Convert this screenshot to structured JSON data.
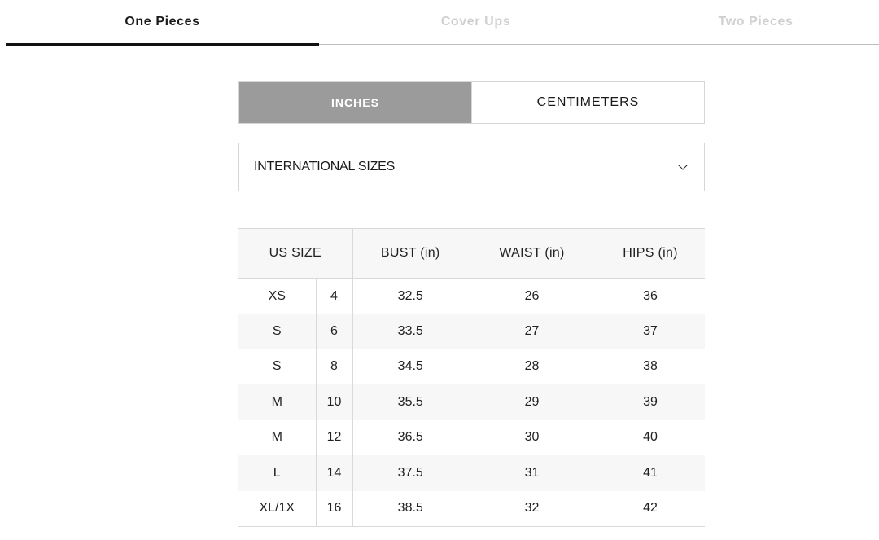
{
  "tabs": [
    {
      "label": "One Pieces",
      "active": true
    },
    {
      "label": "Cover Ups",
      "active": false
    },
    {
      "label": "Two Pieces",
      "active": false
    }
  ],
  "units": {
    "inches_label": "INCHES",
    "centimeters_label": "CENTIMETERS",
    "selected": "INCHES"
  },
  "size_select": {
    "value": "INTERNATIONAL SIZES",
    "icon": "chevron-down-icon"
  },
  "table": {
    "headers": {
      "us_size": "US SIZE",
      "bust": "BUST (in)",
      "waist": "WAIST (in)",
      "hips": "HIPS (in)"
    },
    "rows": [
      {
        "size": "XS",
        "num": "4",
        "bust": "32.5",
        "waist": "26",
        "hips": "36"
      },
      {
        "size": "S",
        "num": "6",
        "bust": "33.5",
        "waist": "27",
        "hips": "37"
      },
      {
        "size": "S",
        "num": "8",
        "bust": "34.5",
        "waist": "28",
        "hips": "38"
      },
      {
        "size": "M",
        "num": "10",
        "bust": "35.5",
        "waist": "29",
        "hips": "39"
      },
      {
        "size": "M",
        "num": "12",
        "bust": "36.5",
        "waist": "30",
        "hips": "40"
      },
      {
        "size": "L",
        "num": "14",
        "bust": "37.5",
        "waist": "31",
        "hips": "41"
      },
      {
        "size": "XL/1X",
        "num": "16",
        "bust": "38.5",
        "waist": "32",
        "hips": "42"
      }
    ]
  },
  "colors": {
    "active_unit_bg": "#9b9b9b",
    "stripe_bg": "#f7f7f7",
    "inactive_tab_text": "#d0d0d0"
  }
}
